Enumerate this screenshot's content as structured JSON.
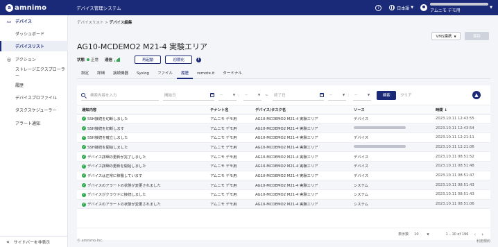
{
  "header": {
    "logo_mark": "a",
    "logo_text": "amnimo",
    "app_title": "デバイス管理システム",
    "help_icon": "question-circle-icon",
    "language": "日本語",
    "user_org": "アムニモ デモ用"
  },
  "sidebar": {
    "items": [
      {
        "label": "デバイス",
        "icon": "router-icon"
      },
      {
        "label": "ダッシュボード"
      },
      {
        "label": "デバイスリスト"
      },
      {
        "label": "アクション",
        "icon": "action-icon"
      },
      {
        "label": "ストレージエクスプローラー"
      },
      {
        "label": "履歴"
      },
      {
        "label": "デバイスプロファイル"
      },
      {
        "label": "タスクスケジューラー"
      },
      {
        "label": "アラート通知"
      }
    ],
    "hide_label": "サイドバーを非表示"
  },
  "breadcrumb": {
    "parent": "デバイスリスト",
    "separator": ">",
    "current": "デバイス編集"
  },
  "toolbar": {
    "vms_label": "VMS連携",
    "save_label": "保存"
  },
  "page_title": "AG10-MCDEMO2 M21-4 実験エリア",
  "status": {
    "status_label": "状態",
    "status_value": "正常",
    "comm_label": "通信",
    "restart_label": "再起動",
    "reset_label": "初期化"
  },
  "tabs": [
    "設定",
    "詳細",
    "接続機器",
    "Syslog",
    "ファイル",
    "履歴",
    "remote.it",
    "ターミナル"
  ],
  "filter": {
    "search_placeholder": "検索内容を入力",
    "start_placeholder": "開始日",
    "end_placeholder": "終了日",
    "time_placeholder": "--",
    "range_separator": "~",
    "search_label": "検索",
    "clear_label": "クリア"
  },
  "table": {
    "headers": [
      "通知内容",
      "テナント名",
      "デバイス/タスク名",
      "ソース",
      "時間 ↓"
    ],
    "rows": [
      {
        "message": "SSH接続を切断しました",
        "tenant": "アムニモ デモ用",
        "device": "AG10-MCDEMO2 M21-4 実験エリア",
        "source": "デバイス",
        "time": "2023.10.11 12:43:55"
      },
      {
        "message": "SSH接続を切断します",
        "tenant": "アムニモ デモ用",
        "device": "AG10-MCDEMO2 M21-4 実験エリア",
        "source": "",
        "time": "2023.10.11 12:43:54"
      },
      {
        "message": "SSH接続を確立しました",
        "tenant": "アムニモ デモ用",
        "device": "AG10-MCDEMO2 M21-4 実験エリア",
        "source": "デバイス",
        "time": "2023.10.11 12:21:11"
      },
      {
        "message": "SSH接続を開始しました",
        "tenant": "アムニモ デモ用",
        "device": "AG10-MCDEMO2 M21-4 実験エリア",
        "source": "",
        "time": "2023.10.11 12:21:06"
      },
      {
        "message": "デバイス詳細の更新が完了しました",
        "tenant": "アムニモ デモ用",
        "device": "AG10-MCDEMO2 M21-4 実験エリア",
        "source": "デバイス",
        "time": "2023.10.11 08:51:52"
      },
      {
        "message": "デバイス詳細の更新を開始しました",
        "tenant": "アムニモ デモ用",
        "device": "AG10-MCDEMO2 M21-4 実験エリア",
        "source": "デバイス",
        "time": "2023.10.11 08:51:48"
      },
      {
        "message": "デバイスは正常に稼働しています",
        "tenant": "アムニモ デモ用",
        "device": "AG10-MCDEMO2 M21-4 実験エリア",
        "source": "デバイス",
        "time": "2023.10.11 08:51:47"
      },
      {
        "message": "デバイスのアラートの状態が変更されました",
        "tenant": "アムニモ デモ用",
        "device": "AG10-MCDEMO2 M21-4 実験エリア",
        "source": "システム",
        "time": "2023.10.11 08:51:43"
      },
      {
        "message": "デバイスがクラウドに接続しました",
        "tenant": "アムニモ デモ用",
        "device": "AG10-MCDEMO2 M21-4 実験エリア",
        "source": "システム",
        "time": "2023.10.11 08:51:43"
      },
      {
        "message": "デバイスのアラートの状態が変更されました",
        "tenant": "アムニモ デモ用",
        "device": "AG10-MCDEMO2 M21-4 実験エリア",
        "source": "システム",
        "time": "2023.10.11 08:51:06"
      }
    ]
  },
  "pager": {
    "per_page_label": "表示数",
    "per_page_value": "10",
    "range": "1 – 10 of 196"
  },
  "footer": {
    "copyright": "© amnimo Inc.",
    "policy": "利用規約"
  },
  "colors": {
    "primary": "#1b2a78",
    "success": "#2fa84f"
  }
}
